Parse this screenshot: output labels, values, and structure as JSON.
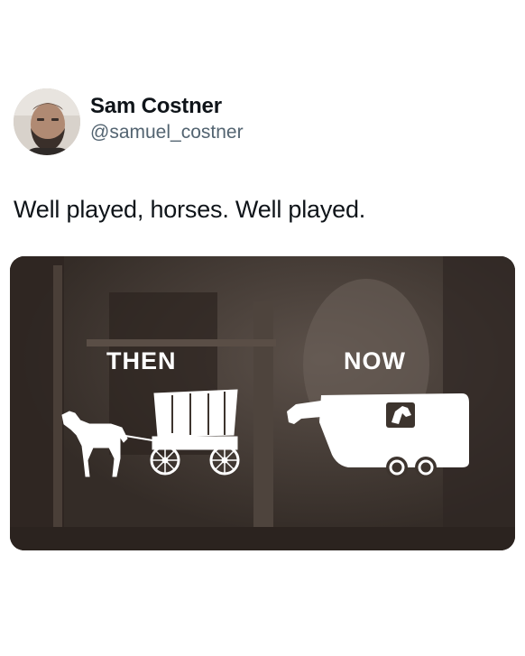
{
  "user": {
    "display_name": "Sam Costner",
    "handle": "@samuel_costner"
  },
  "tweet": {
    "text": "Well played, horses. Well played."
  },
  "image": {
    "left_label": "THEN",
    "right_label": "NOW"
  },
  "colors": {
    "text_primary": "#0f1419",
    "text_secondary": "#536471",
    "image_background": "#3d342e",
    "illustration": "#ffffff"
  }
}
